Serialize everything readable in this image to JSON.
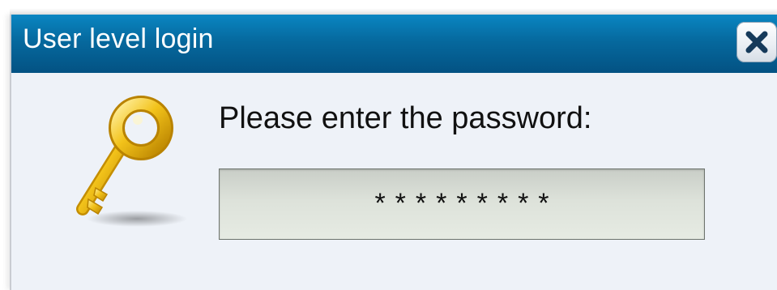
{
  "dialog": {
    "title": "User level login",
    "close_icon": "close-x-icon",
    "key_icon": "gold-key-icon",
    "prompt": "Please enter the password:",
    "password": {
      "masked_value": "*********"
    }
  },
  "colors": {
    "titlebar": "#06699e",
    "title_text": "#ffffff",
    "dialog_background": "#eef2f8",
    "field_background": "#dde2da",
    "key_gold": "#e8b400"
  }
}
